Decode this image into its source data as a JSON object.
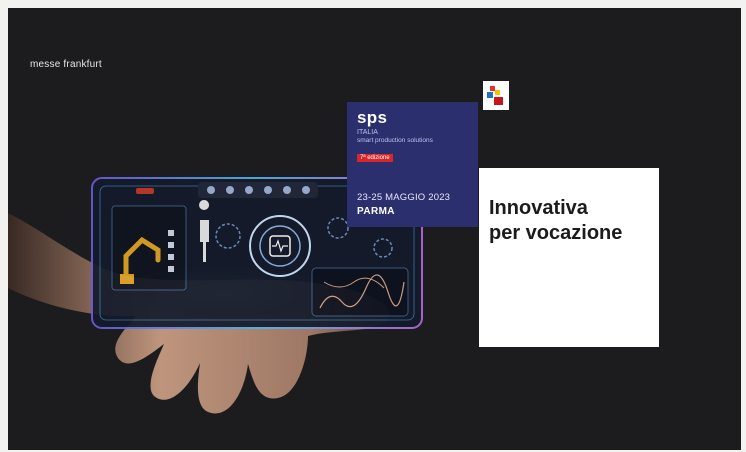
{
  "brand": {
    "name": "messe frankfurt"
  },
  "event": {
    "name": "sps",
    "country": "ITALIA",
    "tagline": "smart production solutions",
    "edition": "7ª edizione",
    "dates": "23-25 MAGGIO 2023",
    "city": "PARMA",
    "color": "#2b2f6e"
  },
  "claim": {
    "line1": "Innovativa",
    "line2": "per vocazione"
  },
  "illustration": {
    "subject": "hand holding holographic industrial control panel"
  }
}
